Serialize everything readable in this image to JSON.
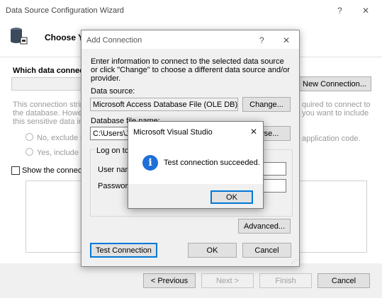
{
  "wizard": {
    "title": "Data Source Configuration Wizard",
    "header": "Choose Y",
    "section_label": "Which data connectio",
    "new_connection_button": "New Connection...",
    "info_lines": [
      "This connection string",
      "the database. However",
      "this sensitive data in th"
    ],
    "info_right_lines": [
      "quired to connect to",
      "you want to include"
    ],
    "radio_exclude": "No, exclude se",
    "radio_include": "Yes, include se",
    "app_code_text": "application code.",
    "show_connection_label": "Show the connectio",
    "previous_button": "< Previous",
    "next_button": "Next >",
    "finish_button": "Finish",
    "cancel_button": "Cancel",
    "help_glyph": "?",
    "close_glyph": "✕"
  },
  "add_connection": {
    "title": "Add Connection",
    "instructions": "Enter information to connect to the selected data source or click \"Change\" to choose a different data source and/or provider.",
    "data_source_label": "Data source:",
    "data_source_value": "Microsoft Access Database File (OLE DB)",
    "change_button": "Change...",
    "db_file_label": "Database file name:",
    "db_file_value": "C:\\Users\\Jaj",
    "browse_button": "owse...",
    "logon_label": "Log on to t",
    "user_name_label": "User nam",
    "password_label": "Passwor",
    "advanced_button": "Advanced...",
    "test_connection_button": "Test Connection",
    "ok_button": "OK",
    "cancel_button": "Cancel",
    "help_glyph": "?",
    "close_glyph": "✕"
  },
  "message_box": {
    "title": "Microsoft Visual Studio",
    "message": "Test connection succeeded.",
    "icon_glyph": "i",
    "ok_button": "OK",
    "close_glyph": "✕"
  }
}
